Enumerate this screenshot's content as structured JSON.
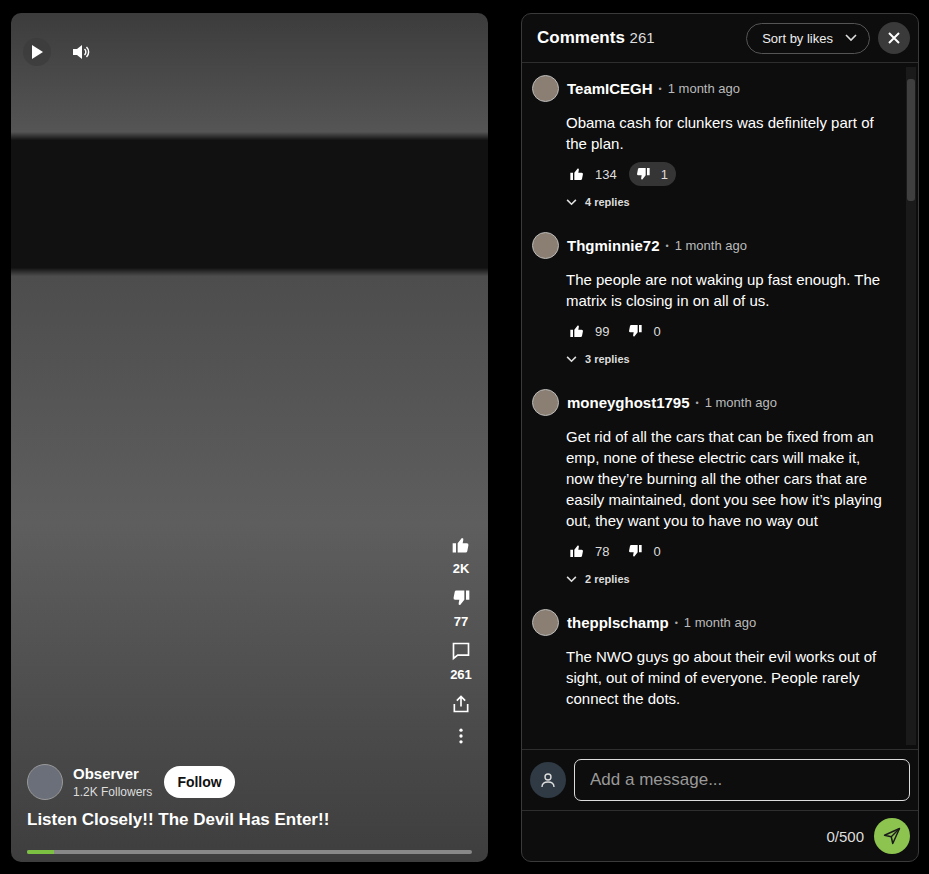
{
  "video": {
    "actions": [
      {
        "kind": "like",
        "count": "2K"
      },
      {
        "kind": "dislike",
        "count": "77"
      },
      {
        "kind": "comment",
        "count": "261"
      },
      {
        "kind": "share",
        "count": ""
      },
      {
        "kind": "more",
        "count": ""
      }
    ],
    "channel": {
      "name": "Observer",
      "followers": "1.2K Followers",
      "follow_button": "Follow"
    },
    "title": "Listen Closely!! The Devil Has Enter!!",
    "progress": {
      "level": 0.06
    }
  },
  "comments_panel": {
    "title": "Comments",
    "count": "261",
    "sort": "Sort by likes"
  },
  "comments": [
    {
      "author": "TeamICEGH",
      "time": "1 month ago",
      "text": "Obama cash for clunkers was definitely part of the plan.",
      "likes": "134",
      "dislikes": "1",
      "liked": false,
      "disliked": true,
      "replies": "4 replies",
      "expanded": false
    },
    {
      "author": "Thgminnie72",
      "time": "1 month ago",
      "text": "The people are not waking up fast enough. The matrix is closing in on all of us.",
      "likes": "99",
      "dislikes": "0",
      "liked": false,
      "disliked": false,
      "replies": "3 replies",
      "expanded": false
    },
    {
      "author": "moneyghost1795",
      "time": "1 month ago",
      "text": "Get rid of all the cars that can be fixed from an emp, none of these electric cars will make it, now they’re burning all the other cars that are easily maintained, dont you see how it’s playing out, they want you to have no way out",
      "likes": "78",
      "dislikes": "0",
      "liked": false,
      "disliked": false,
      "replies": "2 replies",
      "expanded": false
    },
    {
      "author": "thepplschamp",
      "time": "1 month ago",
      "text": "The NWO guys go about their evil works out of sight, out of mind of everyone. People rarely connect the dots."
    }
  ],
  "composer": {
    "placeholder": "Add a message...",
    "counter": "0/500"
  }
}
